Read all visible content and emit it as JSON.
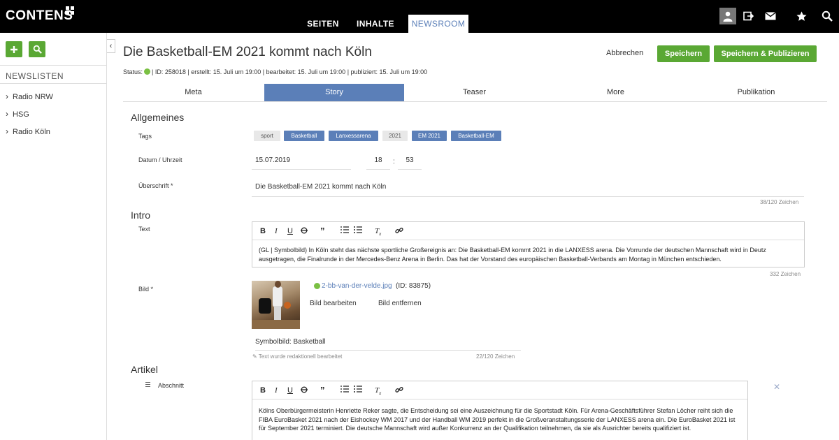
{
  "app": {
    "logo": "CONTENS"
  },
  "nav": {
    "tabs": [
      "SEITEN",
      "INHALTE",
      "NEWSROOM"
    ],
    "active": "NEWSROOM"
  },
  "top_icons": [
    "user-icon",
    "export-icon",
    "mail-icon",
    "star-icon",
    "search-icon"
  ],
  "sidebar": {
    "heading": "NEWSLISTEN",
    "items": [
      {
        "label": "Radio NRW"
      },
      {
        "label": "HSG"
      },
      {
        "label": "Radio Köln"
      }
    ]
  },
  "article": {
    "title": "Die Basketball-EM 2021 kommt nach Köln",
    "meta": {
      "status_label": "Status:",
      "rest": "| ID: 258018 | erstellt: 15. Juli um 19:00 | bearbeitet: 15. Juli um 19:00 | publiziert: 15. Juli um 19:00"
    }
  },
  "actions": {
    "cancel": "Abbrechen",
    "save": "Speichern",
    "save_publish": "Speichern & Publizieren"
  },
  "tabs": [
    {
      "label": "Meta"
    },
    {
      "label": "Story"
    },
    {
      "label": "Teaser"
    },
    {
      "label": "More"
    },
    {
      "label": "Publikation"
    }
  ],
  "sections": {
    "allgemeines": "Allgemeines",
    "intro": "Intro",
    "artikel": "Artikel"
  },
  "fields": {
    "tags_label": "Tags",
    "tags": [
      {
        "label": "sport",
        "style": "grey"
      },
      {
        "label": "Basketball",
        "style": "blue"
      },
      {
        "label": "Lanxessarena",
        "style": "blue"
      },
      {
        "label": "2021",
        "style": "grey"
      },
      {
        "label": "EM 2021",
        "style": "blue"
      },
      {
        "label": "Basketball-EM",
        "style": "blue"
      }
    ],
    "date_label": "Datum / Uhrzeit",
    "date": "15.07.2019",
    "hour": "18",
    "minute": "53",
    "time_sep": ":",
    "headline_label": "Überschrift *",
    "headline": "Die Basketball-EM 2021 kommt nach Köln",
    "headline_counter": "38/120 Zeichen",
    "text_label": "Text",
    "intro_text": "(GL | Symbolbild) In Köln steht das nächste sportliche Großereignis an: Die Basketball-EM kommt 2021 in die LANXESS arena. Die Vorrunde der deutschen Mannschaft wird in Deutz ausgetragen, die Finalrunde in der Mercedes-Benz Arena in Berlin. Das hat der Vorstand des europäischen Basketball-Verbands am Montag in München entschieden.",
    "intro_counter": "332 Zeichen",
    "image_label": "Bild *",
    "image_file": "2-bb-van-der-velde.jpg",
    "image_id": "(ID: 83875)",
    "edit_image": "Bild bearbeiten",
    "remove_image": "Bild entfernen",
    "image_caption": "Symbolbild: Basketball",
    "caption_note": "Text wurde redaktionell bearbeitet",
    "caption_counter": "22/120 Zeichen",
    "section_label": "Abschnitt",
    "article_text": "Kölns Oberbürgermeisterin Henriette Reker sagte, die Entscheidung sei eine Auszeichnung für die Sportstadt Köln. Für Arena-Geschäftsführer Stefan Löcher reiht sich die FIBA EuroBasket 2021 nach der Eishockey WM 2017 und der Handball WM 2019 perfekt in die Großveranstaltungsserie der LANXESS arena ein. Die EuroBasket 2021 ist für September 2021 terminiert. Die deutsche Mannschaft wird außer Konkurrenz an der Qualifikation teilnehmen, da sie als Ausrichter bereits qualifiziert ist."
  },
  "toolbar_icons": [
    "bold-icon",
    "italic-icon",
    "underline-icon",
    "strikethrough-icon",
    "quote-icon",
    "numbered-list-icon",
    "bullet-list-icon",
    "clear-format-icon",
    "link-icon"
  ],
  "colors": {
    "accent_blue": "#5b7fb8",
    "green": "#5aa834",
    "status_green": "#7ac043",
    "topbar": "#000000"
  }
}
